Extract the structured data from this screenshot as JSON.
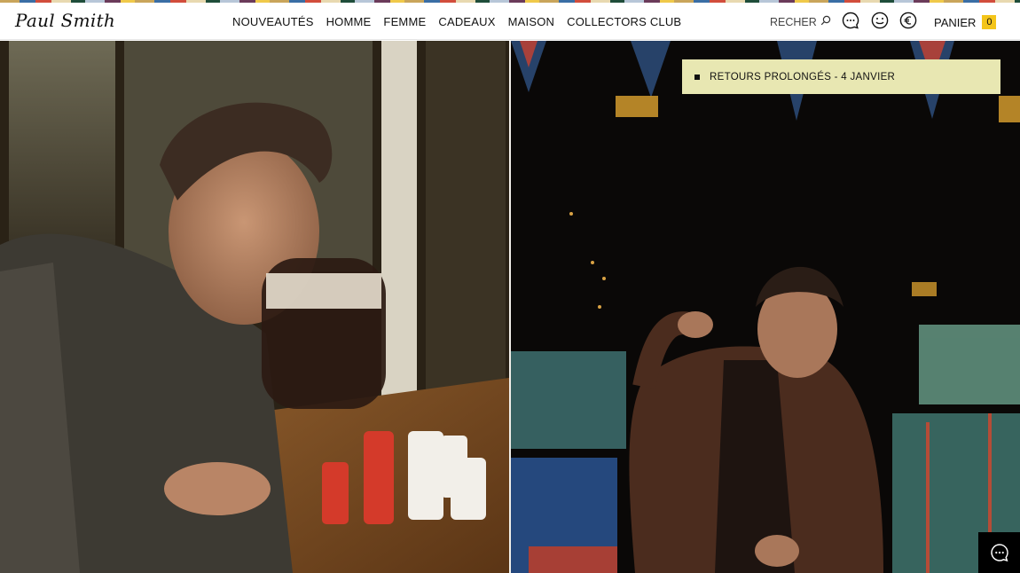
{
  "brand": {
    "logo_text": "Paul Smith"
  },
  "nav": {
    "items": [
      {
        "label": "NOUVEAUTÉS"
      },
      {
        "label": "HOMME"
      },
      {
        "label": "FEMME"
      },
      {
        "label": "CADEAUX"
      },
      {
        "label": "MAISON"
      },
      {
        "label": "COLLECTORS CLUB"
      }
    ]
  },
  "header_tools": {
    "search_label": "RECHER",
    "icons": [
      "search-icon",
      "chat-icon",
      "account-icon",
      "currency-euro-icon"
    ],
    "cart_label": "PANIER",
    "cart_count": "0"
  },
  "banner": {
    "text": "RETOURS PROLONGÉS - 4 JANVIER"
  },
  "colors": {
    "cart_badge": "#f4c51a",
    "banner_bg": "#e8e7b2",
    "chat_fab_bg": "#000000"
  }
}
